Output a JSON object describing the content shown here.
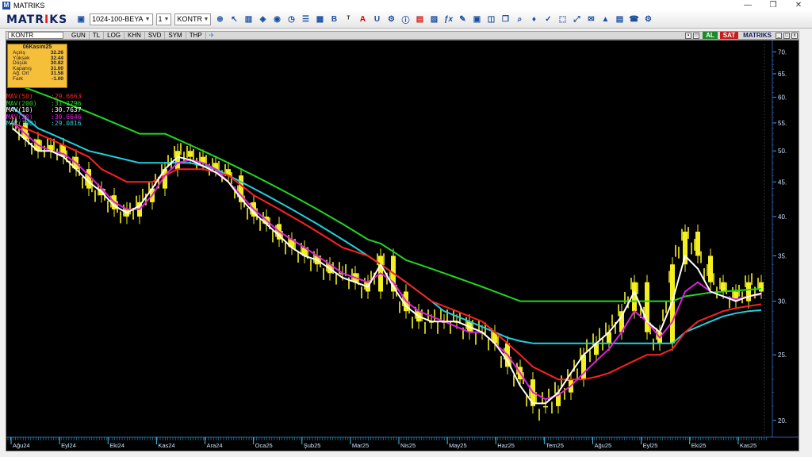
{
  "window": {
    "title": "MATRIKS",
    "logo_letter": "M",
    "controls": {
      "minimize": "—",
      "maximize": "❐",
      "close": "✕"
    }
  },
  "toolbar": {
    "brand_left": "MATR",
    "brand_accent": "I",
    "brand_right": "KS",
    "template_select": "1024-100-BEYA",
    "layout_select": "1",
    "symbol_select": "KONTR",
    "icons": [
      "save-icon",
      "zoom-icon",
      "cursor-icon",
      "bar-chart-icon",
      "indicator-icon",
      "clock-icon",
      "list-icon",
      "table-icon",
      "B",
      "font-icon",
      "A",
      "U",
      "settings-icon",
      "alert-icon",
      "photo-icon",
      "formula-icon",
      "calendar-icon",
      "help-icon"
    ]
  },
  "chart_window": {
    "symbol": "KONTR",
    "periods": [
      "GUN",
      "TL",
      "LOG",
      "KHN",
      "SVD",
      "SYM",
      "THP"
    ],
    "buy_label": "AL",
    "sell_label": "SAT",
    "brand": "MATRIKS"
  },
  "infobox": {
    "title": "06Kasım25",
    "rows": [
      {
        "label": "Açılış",
        "value": "32.26"
      },
      {
        "label": "Yüksek",
        "value": "32.44"
      },
      {
        "label": "Düşük",
        "value": "30.82"
      },
      {
        "label": "Kapanış",
        "value": "31.00"
      },
      {
        "label": "Ağ. Ort",
        "value": "31.58"
      },
      {
        "label": "Fark",
        "value": "-1.00"
      }
    ]
  },
  "legend": [
    {
      "name": "MAV(50)",
      "value": ":29.6663",
      "color": "#ff2020"
    },
    {
      "name": "MAV(200)",
      "value": ":31.2796",
      "color": "#22d622"
    },
    {
      "name": "MAV(10)",
      "value": ":30.7637",
      "color": "#ffffff"
    },
    {
      "name": "MAV(20)",
      "value": ":30.6646",
      "color": "#e020e0"
    },
    {
      "name": "MAV(100)",
      "value": ":29.0816",
      "color": "#20d0e0"
    }
  ],
  "chart_data": {
    "type": "line",
    "x_labels": [
      "Ağu24",
      "Eyl24",
      "Eki24",
      "Kas24",
      "Ara24",
      "Oca25",
      "Şub25",
      "Mar25",
      "Nis25",
      "May25",
      "Haz25",
      "Tem25",
      "Ağu25",
      "Eyl25",
      "Eki25",
      "Kas25"
    ],
    "y_ticks": [
      20,
      25,
      30,
      35,
      40,
      45,
      50,
      55,
      60,
      65,
      70
    ],
    "y_tick_labels": [
      "20.",
      "25.",
      "30.",
      "35.",
      "40.",
      "45.",
      "50.",
      "55.",
      "60.",
      "65.",
      "70."
    ],
    "log_scale": true,
    "ylim": [
      19,
      72
    ],
    "price": [
      55,
      52,
      50,
      51,
      49,
      47,
      44,
      43,
      41,
      40,
      42,
      44,
      47,
      50,
      49,
      48,
      47,
      46,
      42,
      40,
      39,
      37,
      36,
      35,
      34,
      33,
      33,
      32,
      31,
      35,
      31,
      29,
      28,
      28,
      28,
      28,
      27,
      27,
      26,
      24,
      23,
      21,
      21,
      22,
      23,
      25,
      26,
      27,
      29,
      32,
      27,
      26,
      34,
      38,
      35,
      32,
      31,
      30,
      32,
      31
    ],
    "series": [
      {
        "name": "MAV(200)",
        "color": "#22d622",
        "values": [
          63,
          62,
          61,
          60,
          59,
          58,
          57,
          56,
          55,
          54,
          53,
          53,
          53,
          52,
          51,
          50,
          49,
          48,
          47,
          46,
          45,
          44,
          43,
          42,
          41,
          40,
          39,
          38,
          37,
          36.5,
          35.5,
          34.5,
          34,
          33.5,
          33,
          32.5,
          32,
          31.5,
          31,
          30.5,
          30,
          30,
          30,
          30,
          30,
          30,
          30,
          30,
          30,
          30,
          30,
          30,
          30,
          30.5,
          30.7,
          30.9,
          31,
          31.1,
          31.2,
          31.3
        ]
      },
      {
        "name": "MAV(100)",
        "color": "#20d0e0",
        "values": [
          58,
          56,
          54,
          53,
          52,
          51,
          50,
          49.5,
          49,
          48.5,
          48,
          48,
          48,
          48,
          48,
          47.5,
          47,
          46,
          45,
          44,
          43,
          42,
          41,
          40,
          39,
          38,
          37,
          36,
          35,
          34,
          33,
          32,
          31,
          30,
          29,
          28.5,
          28,
          27.5,
          27,
          26.5,
          26.2,
          26,
          26,
          26,
          26,
          26,
          26,
          26,
          26,
          26,
          26,
          26,
          26,
          27,
          27.5,
          28,
          28.5,
          28.8,
          29,
          29.1
        ]
      },
      {
        "name": "MAV(50)",
        "color": "#ff2020",
        "values": [
          55,
          54,
          53,
          52,
          51,
          50,
          49,
          47,
          46,
          45,
          45,
          45,
          46,
          47,
          47,
          47,
          46.5,
          46,
          44.5,
          43,
          42,
          41,
          40,
          39,
          38,
          37,
          36,
          35.5,
          35,
          34,
          33,
          32,
          31,
          30,
          29.5,
          29,
          28.5,
          28,
          27,
          26,
          25,
          24,
          23.5,
          23,
          23,
          23,
          23.2,
          23.5,
          24,
          24.5,
          25,
          25,
          25.5,
          27,
          28,
          28.5,
          29,
          29.3,
          29.5,
          29.7
        ]
      },
      {
        "name": "MAV(20)",
        "color": "#e020e0",
        "values": [
          55,
          53,
          51,
          50,
          49.5,
          48,
          46,
          44,
          42,
          41,
          41,
          43,
          46,
          48,
          48.5,
          48,
          47,
          45,
          43,
          41,
          39.5,
          38,
          37,
          36,
          35,
          34,
          33,
          32.5,
          32,
          33,
          32,
          30,
          29,
          28.5,
          28,
          27.5,
          27,
          27,
          26,
          25,
          23.5,
          22,
          21.5,
          21.8,
          22.5,
          23.5,
          24.5,
          25.5,
          27,
          29,
          28,
          26.5,
          28,
          31,
          32,
          31,
          30.5,
          30.2,
          30.5,
          30.7
        ]
      },
      {
        "name": "MAV(10)",
        "color": "#ffffff",
        "values": [
          54,
          52,
          50,
          50,
          49,
          47,
          45,
          43.5,
          41.5,
          40.5,
          41.5,
          44,
          47,
          49,
          48.5,
          47.5,
          46.5,
          45,
          42.5,
          40.5,
          39,
          37.5,
          36,
          35,
          34.5,
          33.5,
          32.5,
          32,
          31.5,
          34,
          31.5,
          29.5,
          28.5,
          28,
          28,
          28,
          27.5,
          27,
          26,
          24.5,
          22.5,
          21.2,
          21.2,
          22,
          23.5,
          25,
          26,
          27,
          28.5,
          31,
          28,
          27,
          30,
          35,
          33.5,
          31,
          30.5,
          30,
          30.5,
          30.8
        ]
      }
    ]
  }
}
